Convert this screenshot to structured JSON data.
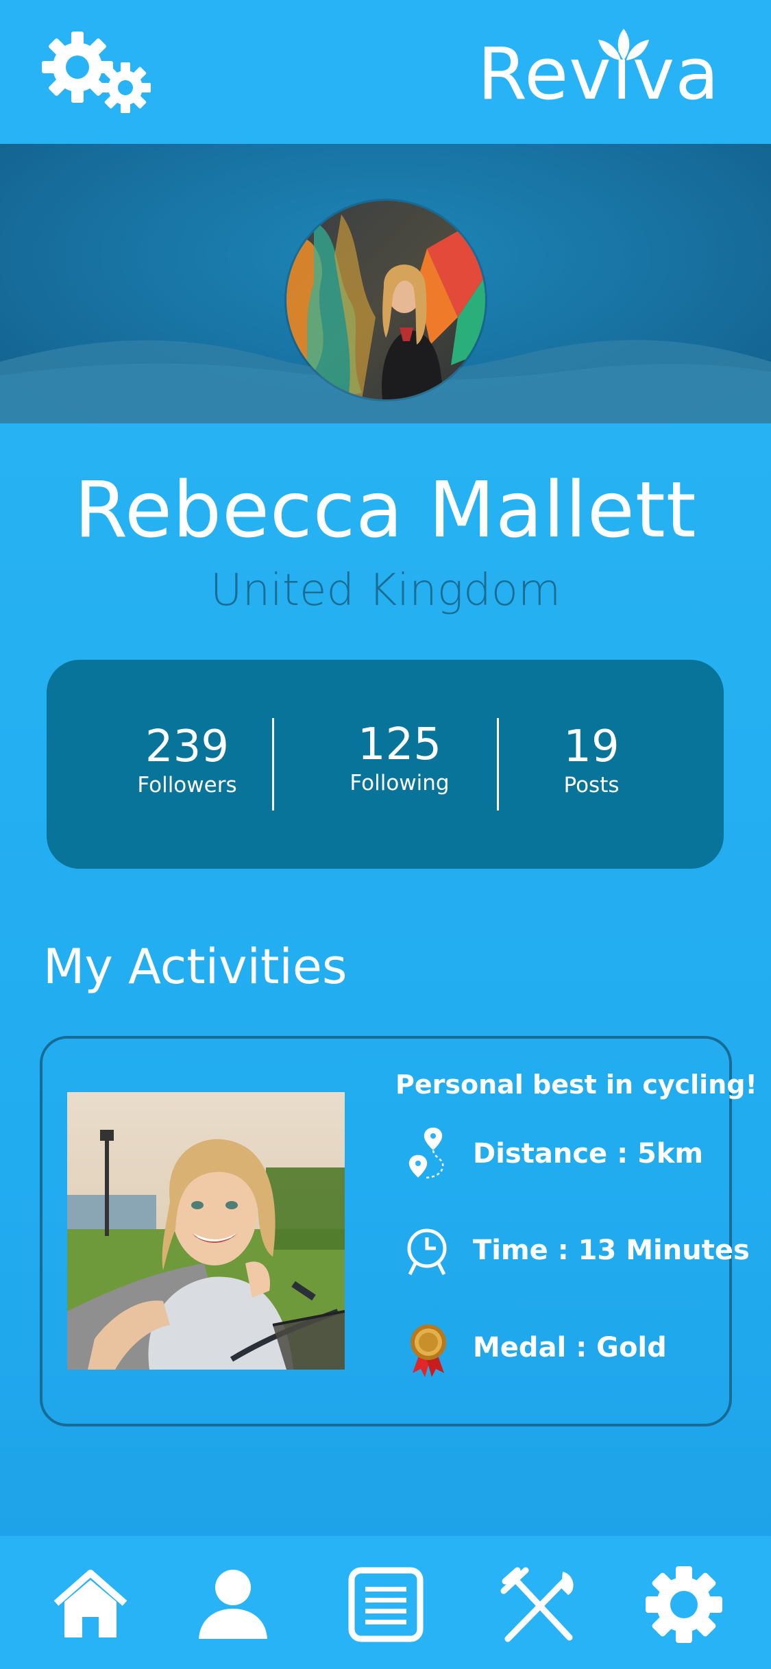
{
  "header": {
    "app_name": "Reviva",
    "settings_icon": "gears-icon"
  },
  "profile": {
    "name": "Rebecca Mallett",
    "country": "United Kingdom",
    "stats": [
      {
        "value": "239",
        "label": "Followers"
      },
      {
        "value": "125",
        "label": "Following"
      },
      {
        "value": "19",
        "label": "Posts"
      }
    ]
  },
  "activities": {
    "section_title": "My Activities",
    "card": {
      "title": "Personal best in cycling!",
      "distance": "Distance : 5km",
      "time": "Time : 13 Minutes",
      "medal": "Medal : Gold"
    }
  },
  "bottom_nav": {
    "items": [
      "home-icon",
      "profile-icon",
      "list-icon",
      "food-icon",
      "settings-icon"
    ]
  },
  "colors": {
    "background": "#27b3f6",
    "stats_card": "#08749a",
    "country_text": "#1b6c93",
    "banner": "#176f9e"
  }
}
